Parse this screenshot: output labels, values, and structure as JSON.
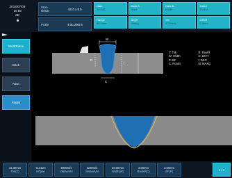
{
  "status": {
    "time": "10:58",
    "date": "2018/07/03",
    "mode_label": "2D"
  },
  "params": [
    {
      "key": "Scan",
      "key2": "sMILE",
      "value": "50.0 x 8.0"
    },
    {
      "key": "Probe",
      "key2": "",
      "value": "4.0L16x0.5"
    }
  ],
  "tiles": [
    {
      "line1": "Gain",
      "line2": "10.0dB"
    },
    {
      "line1": "Gate A",
      "line2": "Start"
    },
    {
      "line1": "Gate B",
      "line2": "Width"
    },
    {
      "line1": "Gate I",
      "line2": "Thresh"
    },
    {
      "line1": "Range",
      "line2": "50.0mm"
    },
    {
      "line1": "Angle",
      "line2": "45deg"
    },
    {
      "line1": "Vel",
      "line2": "3240m/s"
    },
    {
      "line1": "Offset",
      "line2": "0.0mm"
    }
  ],
  "sidebar": {
    "items": [
      {
        "label": "WorkPiece"
      },
      {
        "label": "Back"
      },
      {
        "label": "Next"
      },
      {
        "label": "Finish"
      }
    ]
  },
  "legend": [
    "T: Thk",
    "R: RootR",
    "W: Width",
    "H: LEFT",
    "P: BF",
    "I: DEG",
    "C: RootG",
    "M: MAXG"
  ],
  "diagram_labels": {
    "top": "W",
    "left": "R",
    "right": "T",
    "bottom": "C"
  },
  "bottom": {
    "cells": [
      {
        "value": "31.30mm",
        "label": "Thk(T)"
      },
      {
        "value": "Custom",
        "label": "MType"
      },
      {
        "value": "5900m/s",
        "label": "LWaveVel"
      },
      {
        "value": "3230m/s",
        "label": "SWaveVel"
      },
      {
        "value": "30.00mm",
        "label": "Width(W)"
      },
      {
        "value": "3.00mm",
        "label": "RootW(C)"
      },
      {
        "value": "3.00mm",
        "label": "BF(P)"
      }
    ],
    "page": "1 / 3"
  },
  "colors": {
    "accent": "#1eb1ce",
    "weld": "#1f6fb5",
    "plate": "#8d8d8d"
  }
}
